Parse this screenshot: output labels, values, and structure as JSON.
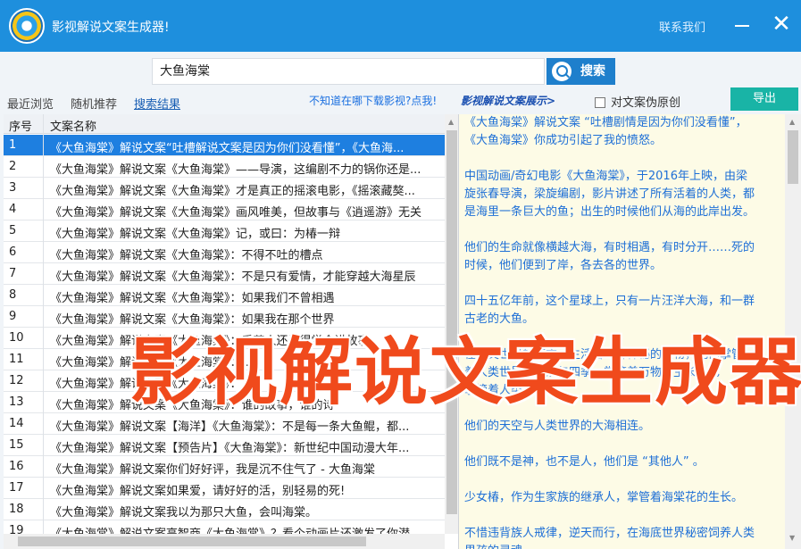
{
  "app": {
    "title": "影视解说文案生成器!",
    "contact": "联系我们",
    "close_glyph": "✕"
  },
  "search": {
    "value": "大鱼海棠",
    "button": "搜索"
  },
  "nav": {
    "recent": "最近浏览",
    "random": "随机推荐",
    "results": "搜索结果"
  },
  "toolbar": {
    "download_link": "不知道在哪下载影视?点我!",
    "showcase": "影视解说文案展示>",
    "checkbox_label": "对文案伪原创",
    "export": "导出"
  },
  "table": {
    "col_no": "序号",
    "col_name": "文案名称",
    "rows": [
      {
        "no": "1",
        "name": "《大鱼海棠》解说文案“吐槽解说文案是因为你们没看懂”，《大鱼海..."
      },
      {
        "no": "2",
        "name": "《大鱼海棠》解说文案《大鱼海棠》——导演，这编剧不力的锅你还是..."
      },
      {
        "no": "3",
        "name": "《大鱼海棠》解说文案《大鱼海棠》才是真正的摇滚电影，《摇滚藏獒..."
      },
      {
        "no": "4",
        "name": "《大鱼海棠》解说文案《大鱼海棠》画风唯美，但故事与《逍遥游》无关"
      },
      {
        "no": "5",
        "name": "《大鱼海棠》解说文案《大鱼海棠》记，或曰：为椿一辩"
      },
      {
        "no": "6",
        "name": "《大鱼海棠》解说文案《大鱼海棠》：不得不吐的槽点"
      },
      {
        "no": "7",
        "name": "《大鱼海棠》解说文案《大鱼海棠》：不是只有爱情，才能穿越大海星辰"
      },
      {
        "no": "8",
        "name": "《大鱼海棠》解说文案《大鱼海棠》：如果我们不曾相遇"
      },
      {
        "no": "9",
        "name": "《大鱼海棠》解说文案《大鱼海棠》：如果我在那个世界"
      },
      {
        "no": "10",
        "name": "《大鱼海棠》解说文案《大鱼海棠》：手艺人还是得学会讲故事"
      },
      {
        "no": "11",
        "name": "《大鱼海棠》解说文案《大鱼海棠》：..."
      },
      {
        "no": "12",
        "name": "《大鱼海棠》解说文案《大鱼海棠》：..."
      },
      {
        "no": "13",
        "name": "《大鱼海棠》解说文案《大鱼海棠》：谁的故事，谁的诗"
      },
      {
        "no": "14",
        "name": "《大鱼海棠》解说文案【海洋】《大鱼海棠》：不是每一条大鱼鲲，都..."
      },
      {
        "no": "15",
        "name": "《大鱼海棠》解说文案【预告片】《大鱼海棠》：新世纪中国动漫大年..."
      },
      {
        "no": "16",
        "name": "《大鱼海棠》解说文案你们好好评，我是沉不住气了 - 大鱼海棠"
      },
      {
        "no": "17",
        "name": "《大鱼海棠》解说文案如果爱，请好好的活，别轻易的死!"
      },
      {
        "no": "18",
        "name": "《大鱼海棠》解说文案我以为那只大鱼，会叫海棠。"
      },
      {
        "no": "19",
        "name": "《大鱼海棠》解说文案高智商《大鱼海棠》？看个动画片还激发了你潜..."
      }
    ]
  },
  "preview": {
    "text": "《大鱼海棠》解说文案 “吐槽剧情是因为你们没看懂”，\n《大鱼海棠》你成功引起了我的愤怒。\n\n中国动画/奇幻电影《大鱼海棠》，于2016年上映，由梁\n旋张春导演，梁旋编剧，影片讲述了所有活着的人类，都\n是海里一条巨大的鱼；出生的时候他们从海的此岸出发。\n\n他们的生命就像横越大海，有时相遇，有时分开……死的\n时候，他们便到了岸，各去各的世界。\n\n四十五亿年前，这个星球上，只有一片汪洋大海，和一群\n古老的大鱼。\n\n在人类世界的下方，生活着一群神秘的生物，他们掌管\n着人类世界的潮汐与四季，掌管着万物的生长，也\n掌管着人类的灵魂。\n\n他们的天空与人类世界的大海相连。\n\n他们既不是神，也不是人，他们是 “其他人” 。\n\n少女椿，作为生家族的继承人，掌管着海棠花的生长。\n\n不惜违背族人戒律，逆天而行，在海底世界秘密饲养人类\n男孩的灵魂……"
  },
  "watermark": "影视解说文案生成器"
}
